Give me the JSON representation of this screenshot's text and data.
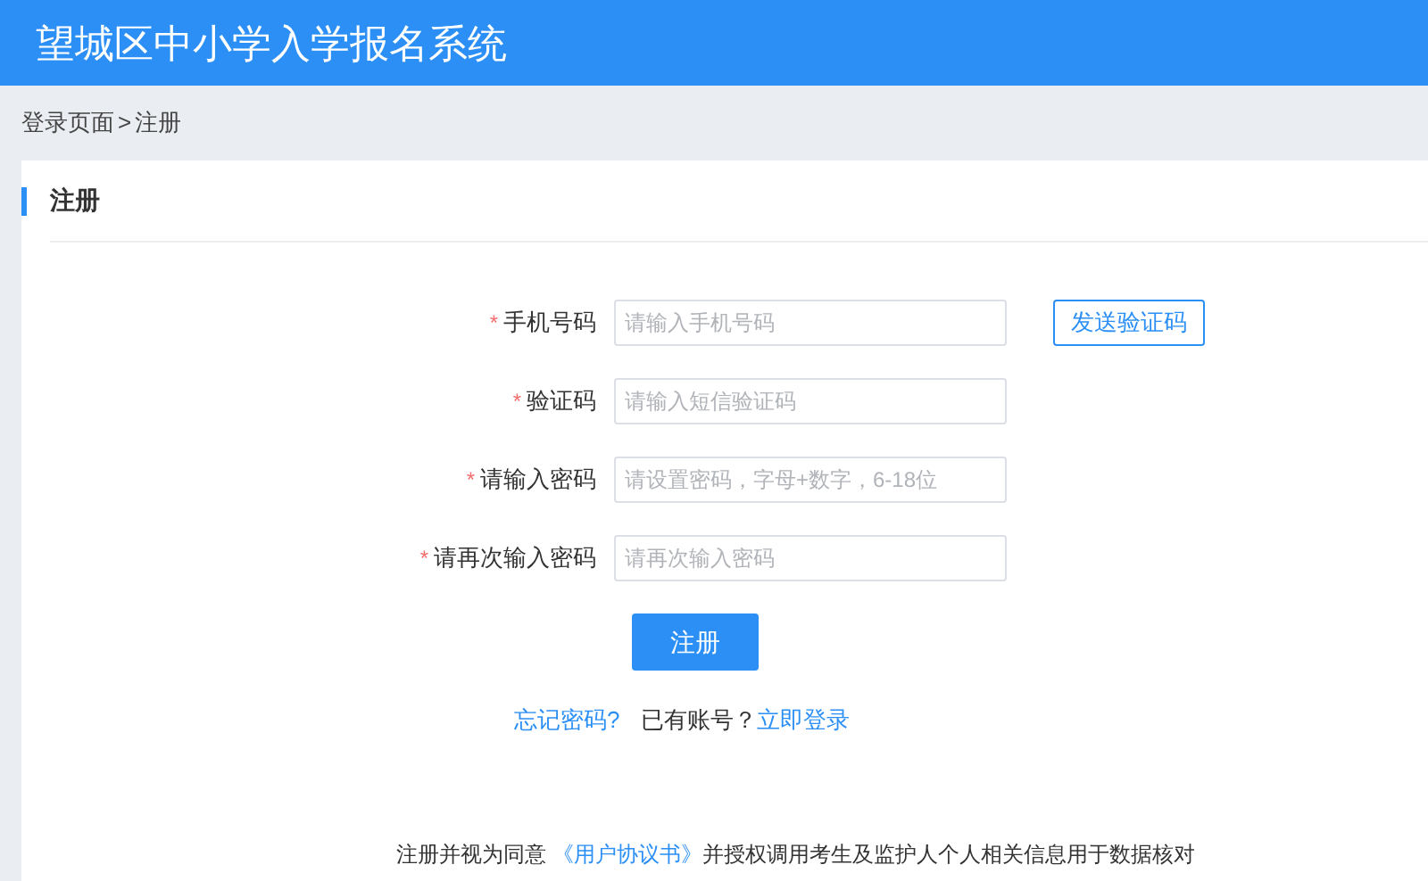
{
  "header": {
    "title": "望城区中小学入学报名系统"
  },
  "breadcrumb": {
    "items": [
      "登录页面",
      "注册"
    ],
    "separator": ">"
  },
  "card": {
    "title": "注册"
  },
  "fields": [
    {
      "mark": "*",
      "label": "手机号码",
      "placeholder": "请输入手机号码",
      "action": "发送验证码"
    },
    {
      "mark": "*",
      "label": "验证码",
      "placeholder": "请输入短信验证码"
    },
    {
      "mark": "*",
      "label": "请输入密码",
      "placeholder": "请设置密码，字母+数字，6-18位"
    },
    {
      "mark": "*",
      "label": "请再次输入密码",
      "placeholder": "请再次输入密码"
    }
  ],
  "submit": "注册",
  "links": {
    "forgot": "忘记密码?",
    "has_account": "已有账号？",
    "login": "立即登录"
  },
  "agreement": {
    "before": "注册并视为同意 ",
    "link": "《用户协议书》",
    "after": "并授权调用考生及监护人个人相关信息用于数据核对"
  }
}
